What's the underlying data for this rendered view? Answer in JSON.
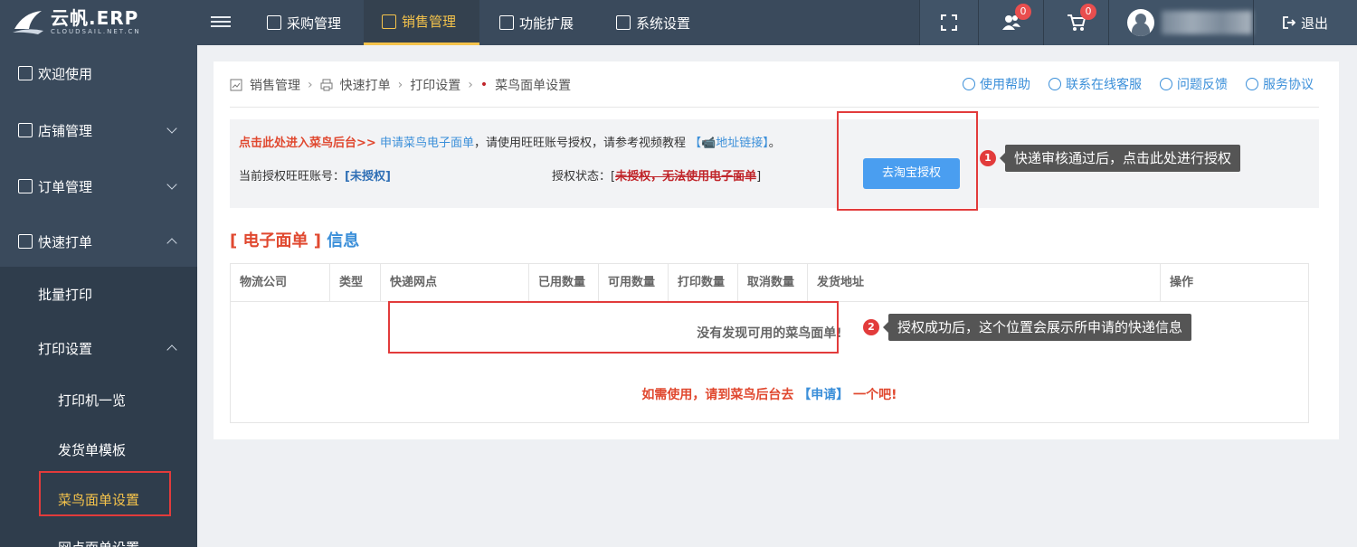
{
  "brand": {
    "title": "云帆.ERP",
    "subtitle": "CLOUDSAIL.NET.CN"
  },
  "topnav": {
    "items": [
      {
        "label": "采购管理",
        "icon": "purchase-icon"
      },
      {
        "label": "销售管理",
        "icon": "sales-chart-icon",
        "active": true
      },
      {
        "label": "功能扩展",
        "icon": "extension-icon"
      },
      {
        "label": "系统设置",
        "icon": "settings-icon"
      }
    ],
    "messages_count": "0",
    "cart_count": "0",
    "logout_label": "退出"
  },
  "sidebar": {
    "items": [
      {
        "label": "欢迎使用"
      },
      {
        "label": "店铺管理"
      },
      {
        "label": "订单管理"
      },
      {
        "label": "快速打单"
      },
      {
        "label": "批量打印"
      },
      {
        "label": "打印设置"
      },
      {
        "label": "打印机一览"
      },
      {
        "label": "发货单模板"
      },
      {
        "label": "菜鸟面单设置"
      },
      {
        "label": "网点面单设置"
      }
    ]
  },
  "breadcrumb": [
    "销售管理",
    "快速打单",
    "打印设置",
    "菜鸟面单设置"
  ],
  "help_links": [
    "使用帮助",
    "联系在线客服",
    "问题反馈",
    "服务协议"
  ],
  "auth": {
    "enter_backend": "点击此处进入菜鸟后台>>",
    "apply_link": "申请菜鸟电子面单",
    "instruction": "，请使用旺旺账号授权，请参考视频教程",
    "video_link": "【📹地址链接】",
    "period": "。",
    "account_label": "当前授权旺旺账号：",
    "account_value": "[未授权]",
    "status_label": "授权状态：",
    "status_open": "[",
    "status_value": "未授权，无法使用电子面单",
    "status_close": "]",
    "button": "去淘宝授权"
  },
  "section": {
    "part1": "[ 电子面单 ]",
    "part2": "信息"
  },
  "table": {
    "headers": [
      "物流公司",
      "类型",
      "快递网点",
      "已用数量",
      "可用数量",
      "打印数量",
      "取消数量",
      "发货地址",
      "操作"
    ],
    "empty_message": "没有发现可用的菜鸟面单!",
    "apply_prefix": "如需使用，请到菜鸟后台去",
    "apply_link": "【申请】",
    "apply_suffix": "一个吧!"
  },
  "callouts": [
    {
      "num": "1",
      "text": "快递审核通过后，点击此处进行授权"
    },
    {
      "num": "2",
      "text": "授权成功后，这个位置会展示所申请的快递信息"
    }
  ]
}
